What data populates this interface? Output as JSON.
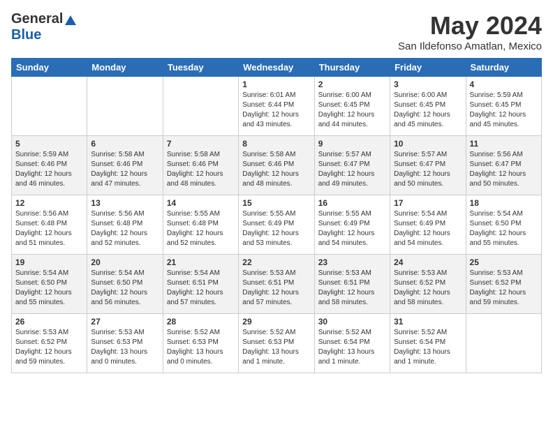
{
  "header": {
    "logo_general": "General",
    "logo_blue": "Blue",
    "month_title": "May 2024",
    "location": "San Ildefonso Amatlan, Mexico"
  },
  "days_of_week": [
    "Sunday",
    "Monday",
    "Tuesday",
    "Wednesday",
    "Thursday",
    "Friday",
    "Saturday"
  ],
  "weeks": [
    [
      {
        "day": "",
        "info": ""
      },
      {
        "day": "",
        "info": ""
      },
      {
        "day": "",
        "info": ""
      },
      {
        "day": "1",
        "info": "Sunrise: 6:01 AM\nSunset: 6:44 PM\nDaylight: 12 hours\nand 43 minutes."
      },
      {
        "day": "2",
        "info": "Sunrise: 6:00 AM\nSunset: 6:45 PM\nDaylight: 12 hours\nand 44 minutes."
      },
      {
        "day": "3",
        "info": "Sunrise: 6:00 AM\nSunset: 6:45 PM\nDaylight: 12 hours\nand 45 minutes."
      },
      {
        "day": "4",
        "info": "Sunrise: 5:59 AM\nSunset: 6:45 PM\nDaylight: 12 hours\nand 45 minutes."
      }
    ],
    [
      {
        "day": "5",
        "info": "Sunrise: 5:59 AM\nSunset: 6:46 PM\nDaylight: 12 hours\nand 46 minutes."
      },
      {
        "day": "6",
        "info": "Sunrise: 5:58 AM\nSunset: 6:46 PM\nDaylight: 12 hours\nand 47 minutes."
      },
      {
        "day": "7",
        "info": "Sunrise: 5:58 AM\nSunset: 6:46 PM\nDaylight: 12 hours\nand 48 minutes."
      },
      {
        "day": "8",
        "info": "Sunrise: 5:58 AM\nSunset: 6:46 PM\nDaylight: 12 hours\nand 48 minutes."
      },
      {
        "day": "9",
        "info": "Sunrise: 5:57 AM\nSunset: 6:47 PM\nDaylight: 12 hours\nand 49 minutes."
      },
      {
        "day": "10",
        "info": "Sunrise: 5:57 AM\nSunset: 6:47 PM\nDaylight: 12 hours\nand 50 minutes."
      },
      {
        "day": "11",
        "info": "Sunrise: 5:56 AM\nSunset: 6:47 PM\nDaylight: 12 hours\nand 50 minutes."
      }
    ],
    [
      {
        "day": "12",
        "info": "Sunrise: 5:56 AM\nSunset: 6:48 PM\nDaylight: 12 hours\nand 51 minutes."
      },
      {
        "day": "13",
        "info": "Sunrise: 5:56 AM\nSunset: 6:48 PM\nDaylight: 12 hours\nand 52 minutes."
      },
      {
        "day": "14",
        "info": "Sunrise: 5:55 AM\nSunset: 6:48 PM\nDaylight: 12 hours\nand 52 minutes."
      },
      {
        "day": "15",
        "info": "Sunrise: 5:55 AM\nSunset: 6:49 PM\nDaylight: 12 hours\nand 53 minutes."
      },
      {
        "day": "16",
        "info": "Sunrise: 5:55 AM\nSunset: 6:49 PM\nDaylight: 12 hours\nand 54 minutes."
      },
      {
        "day": "17",
        "info": "Sunrise: 5:54 AM\nSunset: 6:49 PM\nDaylight: 12 hours\nand 54 minutes."
      },
      {
        "day": "18",
        "info": "Sunrise: 5:54 AM\nSunset: 6:50 PM\nDaylight: 12 hours\nand 55 minutes."
      }
    ],
    [
      {
        "day": "19",
        "info": "Sunrise: 5:54 AM\nSunset: 6:50 PM\nDaylight: 12 hours\nand 55 minutes."
      },
      {
        "day": "20",
        "info": "Sunrise: 5:54 AM\nSunset: 6:50 PM\nDaylight: 12 hours\nand 56 minutes."
      },
      {
        "day": "21",
        "info": "Sunrise: 5:54 AM\nSunset: 6:51 PM\nDaylight: 12 hours\nand 57 minutes."
      },
      {
        "day": "22",
        "info": "Sunrise: 5:53 AM\nSunset: 6:51 PM\nDaylight: 12 hours\nand 57 minutes."
      },
      {
        "day": "23",
        "info": "Sunrise: 5:53 AM\nSunset: 6:51 PM\nDaylight: 12 hours\nand 58 minutes."
      },
      {
        "day": "24",
        "info": "Sunrise: 5:53 AM\nSunset: 6:52 PM\nDaylight: 12 hours\nand 58 minutes."
      },
      {
        "day": "25",
        "info": "Sunrise: 5:53 AM\nSunset: 6:52 PM\nDaylight: 12 hours\nand 59 minutes."
      }
    ],
    [
      {
        "day": "26",
        "info": "Sunrise: 5:53 AM\nSunset: 6:52 PM\nDaylight: 12 hours\nand 59 minutes."
      },
      {
        "day": "27",
        "info": "Sunrise: 5:53 AM\nSunset: 6:53 PM\nDaylight: 13 hours\nand 0 minutes."
      },
      {
        "day": "28",
        "info": "Sunrise: 5:52 AM\nSunset: 6:53 PM\nDaylight: 13 hours\nand 0 minutes."
      },
      {
        "day": "29",
        "info": "Sunrise: 5:52 AM\nSunset: 6:53 PM\nDaylight: 13 hours\nand 1 minute."
      },
      {
        "day": "30",
        "info": "Sunrise: 5:52 AM\nSunset: 6:54 PM\nDaylight: 13 hours\nand 1 minute."
      },
      {
        "day": "31",
        "info": "Sunrise: 5:52 AM\nSunset: 6:54 PM\nDaylight: 13 hours\nand 1 minute."
      },
      {
        "day": "",
        "info": ""
      }
    ]
  ]
}
